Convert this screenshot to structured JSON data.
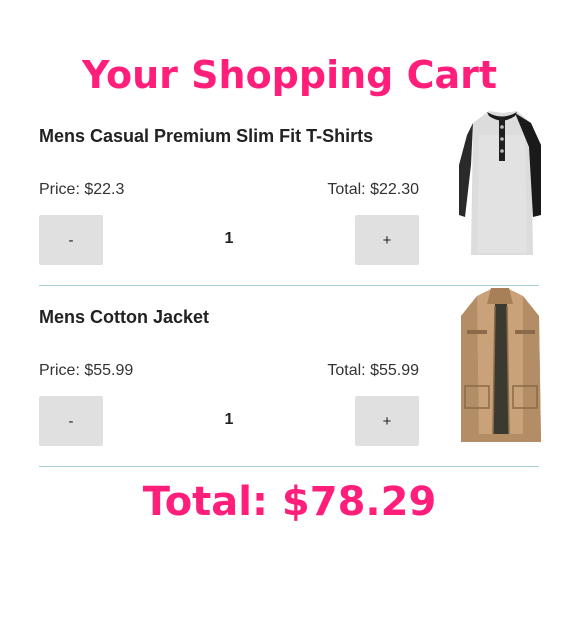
{
  "cart": {
    "title": "Your Shopping Cart",
    "grand_total": "Total: $78.29",
    "items": [
      {
        "name": "Mens Casual Premium Slim Fit T-Shirts",
        "price": "Price: $22.3",
        "total": "Total: $22.30",
        "minus_label": "-",
        "plus_label": "+",
        "quantity": "1",
        "image_icon": "henley-tshirt-image"
      },
      {
        "name": "Mens Cotton Jacket",
        "price": "Price: $55.99",
        "total": "Total: $55.99",
        "minus_label": "-",
        "plus_label": "+",
        "quantity": "1",
        "image_icon": "cotton-jacket-image"
      }
    ]
  },
  "colors": {
    "accent": "#ff1f7a",
    "button_bg": "#e0e0e0",
    "divider": "#a9cfd6"
  }
}
